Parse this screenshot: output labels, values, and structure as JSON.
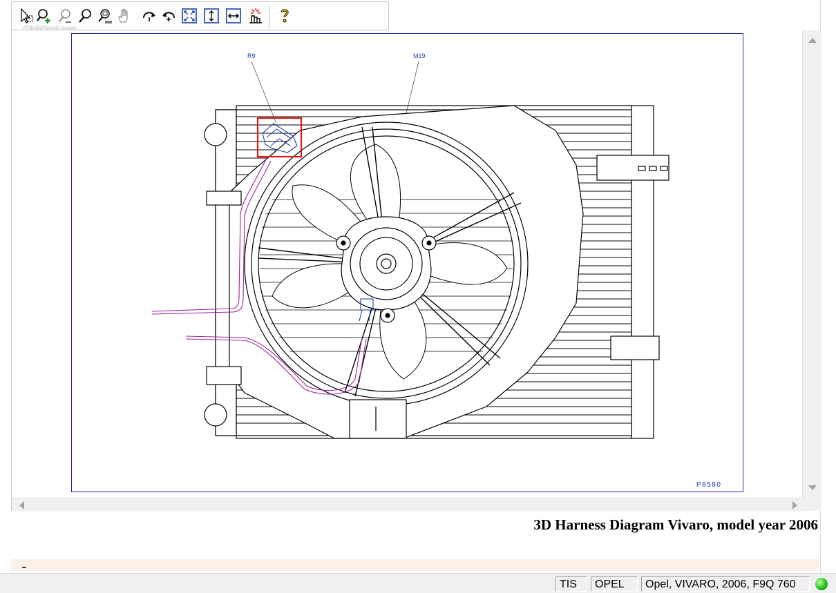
{
  "toolbar": {
    "tools": [
      {
        "icon": "select-pointer-icon"
      },
      {
        "icon": "zoom-in-icon"
      },
      {
        "icon": "zoom-out-icon"
      },
      {
        "icon": "zoom-icon"
      },
      {
        "icon": "zoom-window-icon"
      },
      {
        "icon": "pan-hand-icon"
      },
      {
        "icon": "rotate-right-icon"
      },
      {
        "icon": "rotate-left-icon"
      },
      {
        "icon": "fit-all-icon"
      },
      {
        "icon": "fit-height-icon"
      },
      {
        "icon": "fit-width-icon"
      },
      {
        "icon": "highlight-icon"
      },
      {
        "icon": "help-icon"
      }
    ]
  },
  "watermark": "ClubOpel.com",
  "diagram": {
    "callouts": [
      "R9",
      "M19"
    ],
    "reference": "P8580"
  },
  "caption": "3D Harness Diagram Vivaro, model year 2006",
  "status": {
    "panel1": "TIS",
    "panel2": "OPEL",
    "panel3": "Opel, VIVARO, 2006, F9Q 760",
    "led_color": "#22c21a"
  }
}
